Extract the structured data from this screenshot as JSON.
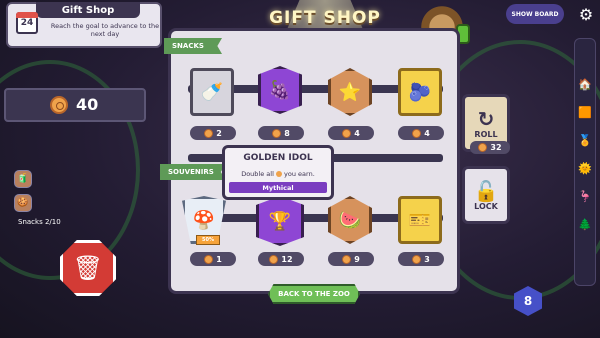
{
  "goal": {
    "title": "Gift Shop",
    "day": "24",
    "description": "Reach the goal to advance to the next day"
  },
  "coins": {
    "amount": "40"
  },
  "snacks_inventory": {
    "label": "Snacks 2/10"
  },
  "shop": {
    "title": "GIFT SHOP",
    "snacks_label": "SNACKS",
    "souvenirs_label": "SOUVENIRS",
    "snacks": [
      {
        "name": "bottle",
        "price": "2"
      },
      {
        "name": "berries",
        "price": "8"
      },
      {
        "name": "star-cookie",
        "price": "4"
      },
      {
        "name": "blueberry",
        "price": "4"
      }
    ],
    "souvenirs": [
      {
        "name": "mushroom",
        "price": "1",
        "discount": "50%"
      },
      {
        "name": "golden-idol",
        "price": "12"
      },
      {
        "name": "fruit-tray",
        "price": "9"
      },
      {
        "name": "green-ticket",
        "price": "3"
      }
    ],
    "back_label": "BACK TO THE ZOO"
  },
  "roll": {
    "label": "ROLL",
    "price": "32"
  },
  "lock": {
    "label": "LOCK"
  },
  "tooltip": {
    "title": "GOLDEN IDOL",
    "desc_prefix": "Double all",
    "desc_suffix": "you earn.",
    "rarity": "Mythical"
  },
  "top_right": {
    "show_board": "SHOW BOARD"
  },
  "level": "8",
  "colors": {
    "rarity_mythical": "#7a3dc0",
    "back_button": "#6fbf57",
    "trash_button": "#d33b35"
  }
}
